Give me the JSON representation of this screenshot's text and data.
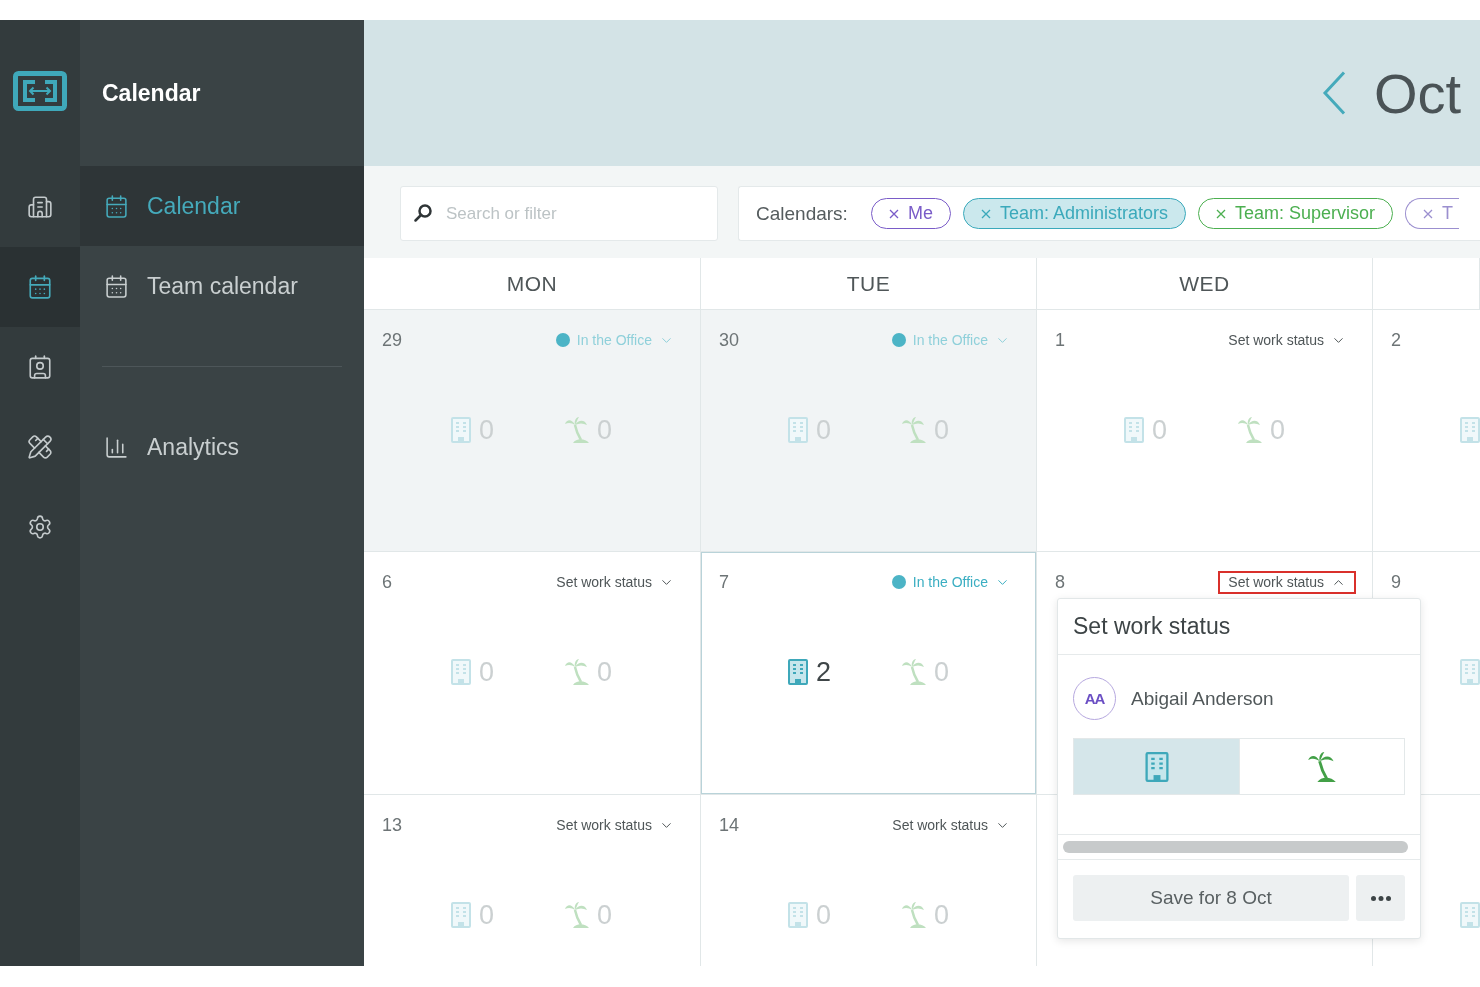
{
  "rail": {
    "items": [
      {
        "kind": "building",
        "selected": false
      },
      {
        "kind": "calendar",
        "selected": true
      },
      {
        "kind": "badge",
        "selected": false
      },
      {
        "kind": "tools",
        "selected": false
      },
      {
        "kind": "settings",
        "selected": false
      }
    ]
  },
  "nav": {
    "title": "Calendar",
    "sections": [
      {
        "items": [
          {
            "label": "Calendar",
            "kind": "calendar",
            "selected": true
          },
          {
            "label": "Team calendar",
            "kind": "calendar",
            "selected": false
          }
        ]
      },
      {
        "items": [
          {
            "label": "Analytics",
            "kind": "chart",
            "selected": false
          }
        ]
      }
    ]
  },
  "header": {
    "month": "Oct"
  },
  "filters": {
    "search": {
      "placeholder": "Search or filter"
    },
    "calendars": {
      "label": "Calendars:",
      "chips": [
        {
          "label": "Me",
          "color": "#7a5cc8",
          "selected": false
        },
        {
          "label": "Team: Administrators",
          "color": "#3ba9bb",
          "selected": true
        },
        {
          "label": "Team: Supervisor",
          "color": "#4caf50",
          "selected": false
        },
        {
          "label": "T",
          "color": "#9b8fcf",
          "selected": false
        }
      ]
    }
  },
  "day_headers": [
    "MON",
    "TUE",
    "WED"
  ],
  "weeks": [
    {
      "days": [
        {
          "day": "29",
          "past": true,
          "today": false,
          "status": {
            "kind": "office",
            "label": "In the Office",
            "open": false,
            "highlighted": false
          },
          "office": {
            "count": "0",
            "active": false
          },
          "leave": {
            "count": "0",
            "active": false
          }
        },
        {
          "day": "30",
          "past": true,
          "today": false,
          "status": {
            "kind": "office",
            "label": "In the Office",
            "open": false,
            "highlighted": false
          },
          "office": {
            "count": "0",
            "active": false
          },
          "leave": {
            "count": "0",
            "active": false
          }
        },
        {
          "day": "1",
          "past": false,
          "today": false,
          "status": {
            "kind": "unset",
            "label": "Set work status",
            "open": false,
            "highlighted": false
          },
          "office": {
            "count": "0",
            "active": false
          },
          "leave": {
            "count": "0",
            "active": false
          }
        },
        {
          "day": "2",
          "past": false,
          "today": false,
          "office": {
            "active": false
          }
        }
      ]
    },
    {
      "days": [
        {
          "day": "6",
          "past": false,
          "today": false,
          "status": {
            "kind": "unset",
            "label": "Set work status",
            "open": false,
            "highlighted": false
          },
          "office": {
            "count": "0",
            "active": false
          },
          "leave": {
            "count": "0",
            "active": false
          }
        },
        {
          "day": "7",
          "past": false,
          "today": true,
          "status": {
            "kind": "office",
            "label": "In the Office",
            "open": false,
            "highlighted": false
          },
          "office": {
            "count": "2",
            "active": true
          },
          "leave": {
            "count": "0",
            "active": false
          }
        },
        {
          "day": "8",
          "past": false,
          "today": false,
          "status": {
            "kind": "unset",
            "label": "Set work status",
            "open": true,
            "highlighted": true
          }
        },
        {
          "day": "9",
          "past": false,
          "today": false,
          "office": {
            "active": false
          }
        }
      ]
    },
    {
      "days": [
        {
          "day": "13",
          "past": false,
          "today": false,
          "status": {
            "kind": "unset",
            "label": "Set work status",
            "open": false,
            "highlighted": false
          },
          "office": {
            "count": "0",
            "active": false
          },
          "leave": {
            "count": "0",
            "active": false
          }
        },
        {
          "day": "14",
          "past": false,
          "today": false,
          "status": {
            "kind": "unset",
            "label": "Set work status",
            "open": false,
            "highlighted": false
          },
          "office": {
            "count": "0",
            "active": false
          },
          "leave": {
            "count": "0",
            "active": false
          }
        },
        {
          "past": false,
          "today": false
        },
        {
          "past": false,
          "today": false,
          "office": {
            "active": false
          }
        }
      ]
    }
  ],
  "popup": {
    "title": "Set work status",
    "user": {
      "initials": "AA",
      "name": "Abigail Anderson"
    },
    "options": [
      {
        "kind": "office",
        "selected": true
      },
      {
        "kind": "leave",
        "selected": false
      }
    ],
    "save_label": "Save for 8 Oct"
  }
}
